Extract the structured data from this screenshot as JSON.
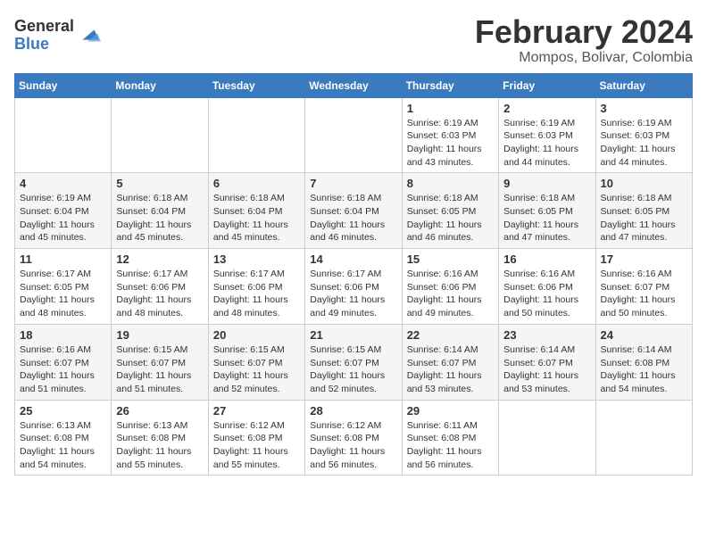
{
  "logo": {
    "general": "General",
    "blue": "Blue"
  },
  "title": {
    "month": "February 2024",
    "location": "Mompos, Bolivar, Colombia"
  },
  "headers": [
    "Sunday",
    "Monday",
    "Tuesday",
    "Wednesday",
    "Thursday",
    "Friday",
    "Saturday"
  ],
  "weeks": [
    [
      {
        "day": "",
        "info": ""
      },
      {
        "day": "",
        "info": ""
      },
      {
        "day": "",
        "info": ""
      },
      {
        "day": "",
        "info": ""
      },
      {
        "day": "1",
        "sunrise": "Sunrise: 6:19 AM",
        "sunset": "Sunset: 6:03 PM",
        "daylight": "Daylight: 11 hours and 43 minutes."
      },
      {
        "day": "2",
        "sunrise": "Sunrise: 6:19 AM",
        "sunset": "Sunset: 6:03 PM",
        "daylight": "Daylight: 11 hours and 44 minutes."
      },
      {
        "day": "3",
        "sunrise": "Sunrise: 6:19 AM",
        "sunset": "Sunset: 6:03 PM",
        "daylight": "Daylight: 11 hours and 44 minutes."
      }
    ],
    [
      {
        "day": "4",
        "sunrise": "Sunrise: 6:19 AM",
        "sunset": "Sunset: 6:04 PM",
        "daylight": "Daylight: 11 hours and 45 minutes."
      },
      {
        "day": "5",
        "sunrise": "Sunrise: 6:18 AM",
        "sunset": "Sunset: 6:04 PM",
        "daylight": "Daylight: 11 hours and 45 minutes."
      },
      {
        "day": "6",
        "sunrise": "Sunrise: 6:18 AM",
        "sunset": "Sunset: 6:04 PM",
        "daylight": "Daylight: 11 hours and 45 minutes."
      },
      {
        "day": "7",
        "sunrise": "Sunrise: 6:18 AM",
        "sunset": "Sunset: 6:04 PM",
        "daylight": "Daylight: 11 hours and 46 minutes."
      },
      {
        "day": "8",
        "sunrise": "Sunrise: 6:18 AM",
        "sunset": "Sunset: 6:05 PM",
        "daylight": "Daylight: 11 hours and 46 minutes."
      },
      {
        "day": "9",
        "sunrise": "Sunrise: 6:18 AM",
        "sunset": "Sunset: 6:05 PM",
        "daylight": "Daylight: 11 hours and 47 minutes."
      },
      {
        "day": "10",
        "sunrise": "Sunrise: 6:18 AM",
        "sunset": "Sunset: 6:05 PM",
        "daylight": "Daylight: 11 hours and 47 minutes."
      }
    ],
    [
      {
        "day": "11",
        "sunrise": "Sunrise: 6:17 AM",
        "sunset": "Sunset: 6:05 PM",
        "daylight": "Daylight: 11 hours and 48 minutes."
      },
      {
        "day": "12",
        "sunrise": "Sunrise: 6:17 AM",
        "sunset": "Sunset: 6:06 PM",
        "daylight": "Daylight: 11 hours and 48 minutes."
      },
      {
        "day": "13",
        "sunrise": "Sunrise: 6:17 AM",
        "sunset": "Sunset: 6:06 PM",
        "daylight": "Daylight: 11 hours and 48 minutes."
      },
      {
        "day": "14",
        "sunrise": "Sunrise: 6:17 AM",
        "sunset": "Sunset: 6:06 PM",
        "daylight": "Daylight: 11 hours and 49 minutes."
      },
      {
        "day": "15",
        "sunrise": "Sunrise: 6:16 AM",
        "sunset": "Sunset: 6:06 PM",
        "daylight": "Daylight: 11 hours and 49 minutes."
      },
      {
        "day": "16",
        "sunrise": "Sunrise: 6:16 AM",
        "sunset": "Sunset: 6:06 PM",
        "daylight": "Daylight: 11 hours and 50 minutes."
      },
      {
        "day": "17",
        "sunrise": "Sunrise: 6:16 AM",
        "sunset": "Sunset: 6:07 PM",
        "daylight": "Daylight: 11 hours and 50 minutes."
      }
    ],
    [
      {
        "day": "18",
        "sunrise": "Sunrise: 6:16 AM",
        "sunset": "Sunset: 6:07 PM",
        "daylight": "Daylight: 11 hours and 51 minutes."
      },
      {
        "day": "19",
        "sunrise": "Sunrise: 6:15 AM",
        "sunset": "Sunset: 6:07 PM",
        "daylight": "Daylight: 11 hours and 51 minutes."
      },
      {
        "day": "20",
        "sunrise": "Sunrise: 6:15 AM",
        "sunset": "Sunset: 6:07 PM",
        "daylight": "Daylight: 11 hours and 52 minutes."
      },
      {
        "day": "21",
        "sunrise": "Sunrise: 6:15 AM",
        "sunset": "Sunset: 6:07 PM",
        "daylight": "Daylight: 11 hours and 52 minutes."
      },
      {
        "day": "22",
        "sunrise": "Sunrise: 6:14 AM",
        "sunset": "Sunset: 6:07 PM",
        "daylight": "Daylight: 11 hours and 53 minutes."
      },
      {
        "day": "23",
        "sunrise": "Sunrise: 6:14 AM",
        "sunset": "Sunset: 6:07 PM",
        "daylight": "Daylight: 11 hours and 53 minutes."
      },
      {
        "day": "24",
        "sunrise": "Sunrise: 6:14 AM",
        "sunset": "Sunset: 6:08 PM",
        "daylight": "Daylight: 11 hours and 54 minutes."
      }
    ],
    [
      {
        "day": "25",
        "sunrise": "Sunrise: 6:13 AM",
        "sunset": "Sunset: 6:08 PM",
        "daylight": "Daylight: 11 hours and 54 minutes."
      },
      {
        "day": "26",
        "sunrise": "Sunrise: 6:13 AM",
        "sunset": "Sunset: 6:08 PM",
        "daylight": "Daylight: 11 hours and 55 minutes."
      },
      {
        "day": "27",
        "sunrise": "Sunrise: 6:12 AM",
        "sunset": "Sunset: 6:08 PM",
        "daylight": "Daylight: 11 hours and 55 minutes."
      },
      {
        "day": "28",
        "sunrise": "Sunrise: 6:12 AM",
        "sunset": "Sunset: 6:08 PM",
        "daylight": "Daylight: 11 hours and 56 minutes."
      },
      {
        "day": "29",
        "sunrise": "Sunrise: 6:11 AM",
        "sunset": "Sunset: 6:08 PM",
        "daylight": "Daylight: 11 hours and 56 minutes."
      },
      {
        "day": "",
        "info": ""
      },
      {
        "day": "",
        "info": ""
      }
    ]
  ]
}
